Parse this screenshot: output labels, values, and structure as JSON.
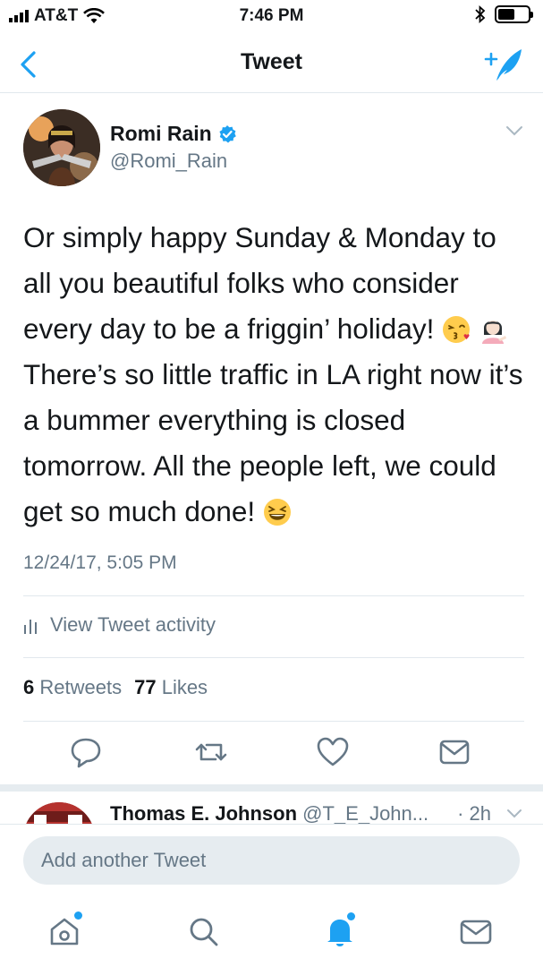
{
  "status_bar": {
    "carrier": "AT&T",
    "time": "7:46 PM"
  },
  "nav": {
    "title": "Tweet"
  },
  "tweet": {
    "author_name": "Romi Rain",
    "author_handle": "@Romi_Rain",
    "text_part1": "Or simply happy Sunday & Monday to all you beautiful folks who consider every day to be a friggin’ holiday! ",
    "text_part2": " There’s so little traffic in LA right now it’s a bummer everything is closed tomorrow. All the people left, we could get so much done! ",
    "timestamp": "12/24/17, 5:05 PM",
    "activity_label": "View Tweet activity",
    "retweet_count": "6",
    "retweet_label": "Retweets",
    "like_count": "77",
    "like_label": "Likes"
  },
  "reply": {
    "name": "Thomas E. Johnson",
    "handle": "@T_E_John...",
    "time": "· 2h"
  },
  "compose": {
    "placeholder": "Add another Tweet"
  },
  "colors": {
    "accent": "#1da1f2",
    "muted": "#657786",
    "divider": "#e1e8ed"
  },
  "icons": [
    "back-chevron-icon",
    "compose-tweet-icon",
    "verified-badge-icon",
    "chevron-down-icon",
    "activity-bars-icon",
    "reply-icon",
    "retweet-icon",
    "like-heart-icon",
    "direct-message-icon",
    "home-icon",
    "search-icon",
    "notifications-bell-icon",
    "messages-envelope-icon"
  ]
}
